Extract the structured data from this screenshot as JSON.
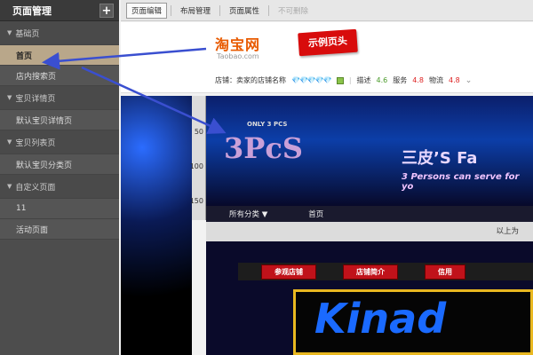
{
  "sidebar": {
    "title": "页面管理",
    "add_label": "+",
    "groups": [
      {
        "label": "基础页",
        "items": [
          "首页",
          "店内搜索页"
        ]
      },
      {
        "label": "宝贝详情页",
        "items": [
          "默认宝贝详情页"
        ]
      },
      {
        "label": "宝贝列表页",
        "items": [
          "默认宝贝分类页"
        ]
      },
      {
        "label": "自定义页面",
        "items": [
          "11",
          "活动页面"
        ]
      }
    ],
    "active_item": "首页"
  },
  "toolbar": {
    "page_edit": "页面编辑",
    "layout_manage": "布局管理",
    "page_props": "页面属性",
    "cannot_delete": "不可删除"
  },
  "header": {
    "logo_cn": "淘宝网",
    "logo_en": "Taobao.com",
    "tag": "示例页头",
    "shop_label": "店铺：卖家的店铺名称",
    "diamonds": "💎💎💎💎💎",
    "desc_label": "描述",
    "desc_score": "4.6",
    "service_label": "服务",
    "service_score": "4.8",
    "logistics_label": "物流",
    "logistics_score": "4.8",
    "chevron": "⌄"
  },
  "ruler": {
    "ticks": [
      "50",
      "100",
      "150"
    ]
  },
  "banner": {
    "brand": "3PcS",
    "brand_cn": "三皮’S Fa",
    "tagline": "3 Persons can serve for yo",
    "small_text": "ONLY 3 PCS"
  },
  "nav": {
    "all_categories": "所有分类 ▼",
    "home": "首页"
  },
  "info_bar": {
    "text": "以上为"
  },
  "menu": {
    "items": [
      "参观店铺",
      "店铺简介",
      "信用"
    ]
  },
  "bottom": {
    "big_word": "Kinad"
  },
  "colors": {
    "accent": "#d80c0c",
    "sidebar_bg": "#4d4d4d",
    "active_item_bg": "#b9a78a",
    "arrow": "#3a4fd0"
  }
}
